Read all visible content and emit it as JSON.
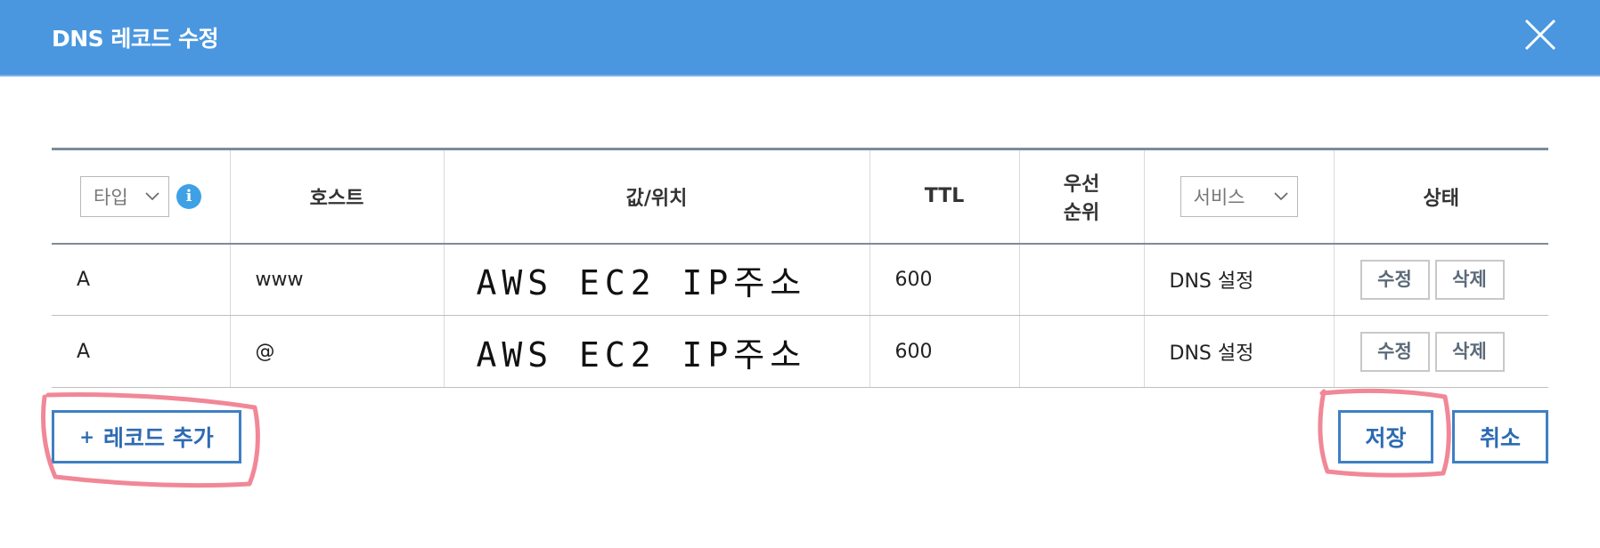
{
  "dialog": {
    "title": "DNS 레코드 수정",
    "close_icon": "close-icon"
  },
  "table": {
    "headers": {
      "type_select": "타입",
      "host": "호스트",
      "value": "값/위치",
      "ttl": "TTL",
      "priority_line1": "우선",
      "priority_line2": "순위",
      "service_select": "서비스",
      "status": "상태"
    },
    "rows": [
      {
        "type": "A",
        "host": "www",
        "value": "AWS EC2 IP주소",
        "ttl": "600",
        "priority": "",
        "service": "DNS 설정",
        "edit": "수정",
        "delete": "삭제"
      },
      {
        "type": "A",
        "host": "@",
        "value": "AWS EC2 IP주소",
        "ttl": "600",
        "priority": "",
        "service": "DNS 설정",
        "edit": "수정",
        "delete": "삭제"
      }
    ]
  },
  "actions": {
    "add_record": "레코드 추가",
    "add_plus": "+",
    "save": "저장",
    "cancel": "취소"
  },
  "colors": {
    "header_bar": "#4a97e0",
    "button_border": "#3f7fc4",
    "annotation": "#f07a8c"
  }
}
